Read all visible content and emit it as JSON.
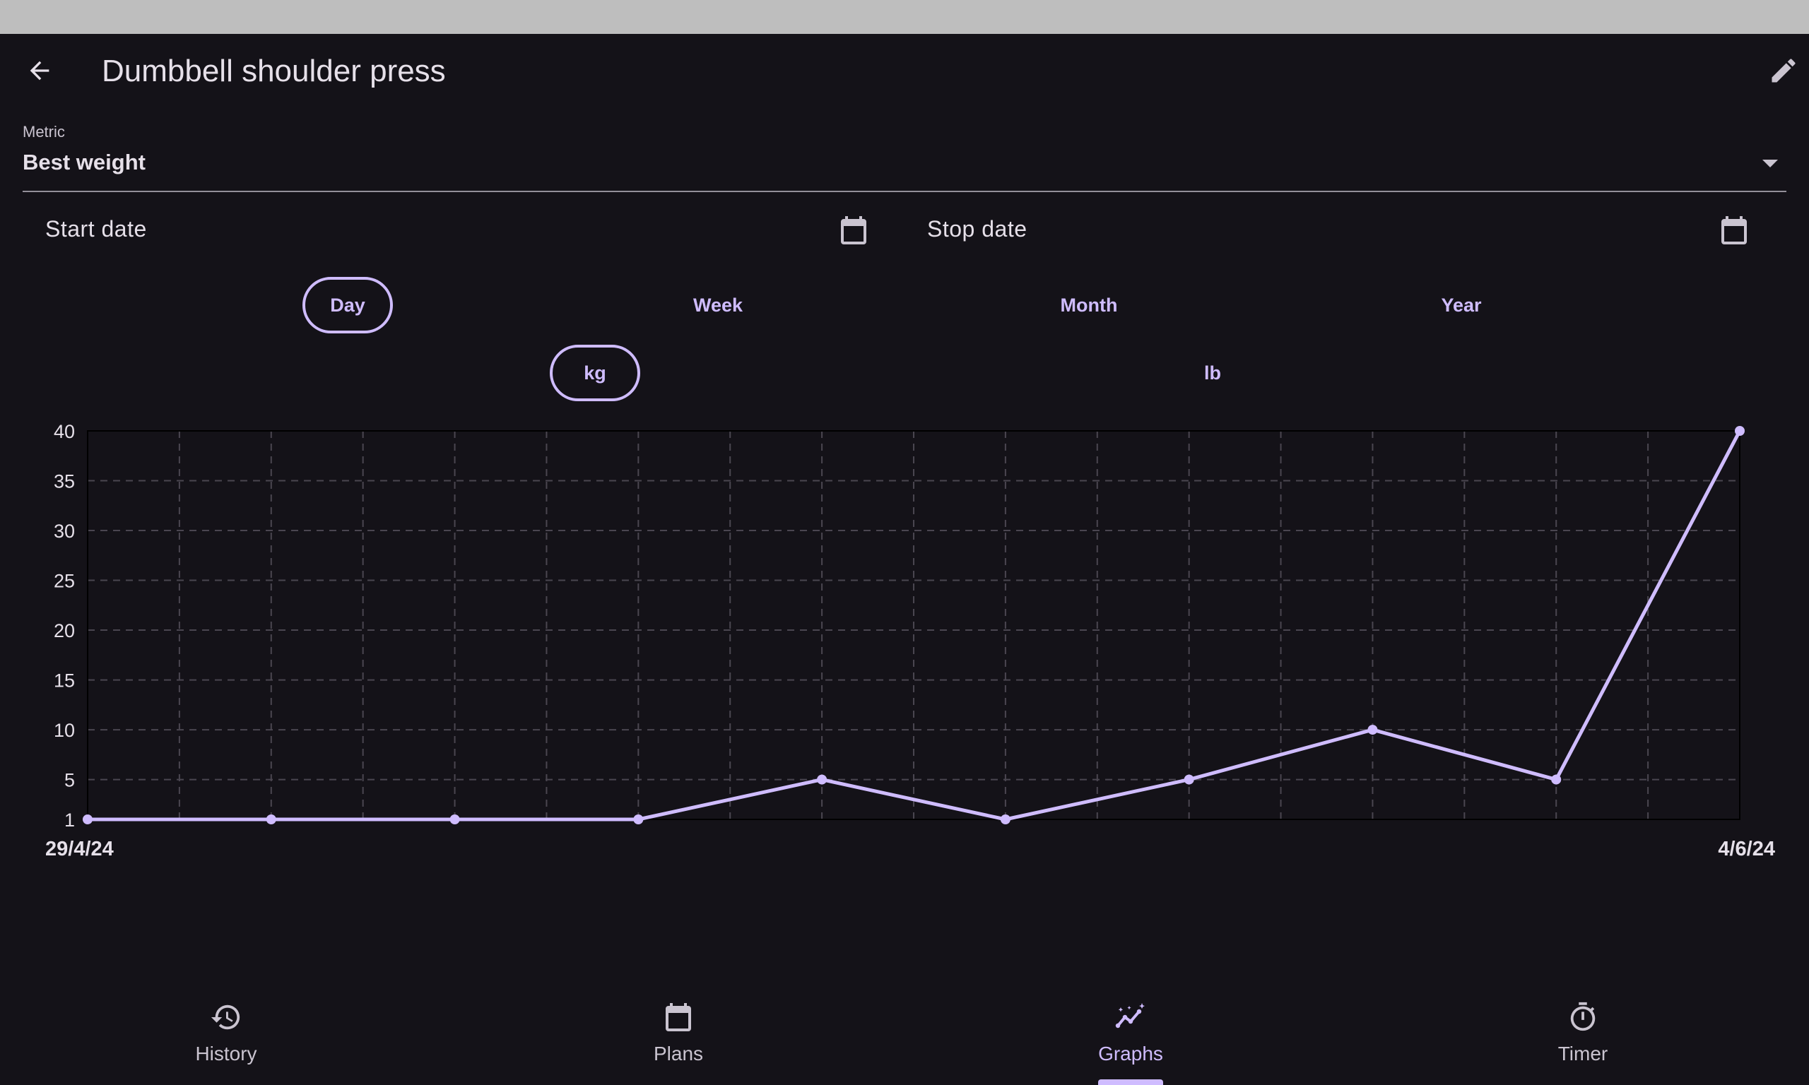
{
  "app": {
    "title": "Dumbbell shoulder press"
  },
  "icons": {
    "back": "arrow-left-icon",
    "edit": "pencil-icon",
    "calendar": "calendar-icon",
    "dropdown": "caret-down-icon"
  },
  "metric": {
    "label": "Metric",
    "value": "Best weight"
  },
  "dates": {
    "start_label": "Start date",
    "stop_label": "Stop date"
  },
  "period": {
    "options": [
      "Day",
      "Week",
      "Month",
      "Year"
    ],
    "selected": "Day"
  },
  "unit": {
    "options": [
      "kg",
      "lb"
    ],
    "selected": "kg"
  },
  "colors": {
    "background": "#141218",
    "accent": "#cfbcff",
    "text": "#e6e0e9",
    "muted": "#cac4d0",
    "grid": "#4a4650"
  },
  "chart_data": {
    "type": "line",
    "x": [
      "29/4/24",
      "",
      "",
      "",
      "",
      "",
      "",
      "",
      "",
      "4/6/24"
    ],
    "series": [
      {
        "values": [
          1,
          1,
          1,
          1,
          5,
          1,
          5,
          10,
          5,
          40
        ]
      }
    ],
    "y_ticks": [
      1,
      5,
      10,
      15,
      20,
      25,
      30,
      35,
      40
    ],
    "ylim": [
      1,
      40
    ],
    "x_start_label": "29/4/24",
    "x_end_label": "4/6/24",
    "grid": true,
    "title": "",
    "xlabel": "",
    "ylabel": ""
  },
  "nav": {
    "items": [
      {
        "label": "History",
        "icon": "history-icon"
      },
      {
        "label": "Plans",
        "icon": "calendar-icon"
      },
      {
        "label": "Graphs",
        "icon": "graph-sparkle-icon"
      },
      {
        "label": "Timer",
        "icon": "timer-icon"
      }
    ],
    "active": "Graphs"
  }
}
